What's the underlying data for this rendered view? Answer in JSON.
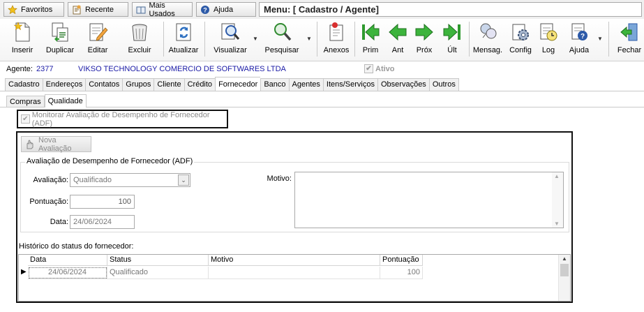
{
  "quickbar": {
    "favoritos": "Favoritos",
    "recente": "Recente",
    "mais_usados": "Mais Usados",
    "ajuda": "Ajuda",
    "menu_title": "Menu: [ Cadastro / Agente]"
  },
  "toolbar": {
    "inserir": "Inserir",
    "duplicar": "Duplicar",
    "editar": "Editar",
    "excluir": "Excluir",
    "atualizar": "Atualizar",
    "visualizar": "Visualizar",
    "pesquisar": "Pesquisar",
    "anexos": "Anexos",
    "prim": "Prim",
    "ant": "Ant",
    "prox": "Próx",
    "ult": "Últ",
    "mensag": "Mensag.",
    "config": "Config",
    "log": "Log",
    "ajuda": "Ajuda",
    "fechar": "Fechar"
  },
  "agent": {
    "label": "Agente:",
    "code": "2377",
    "name": "VIKSO TECHNOLOGY COMERCIO DE SOFTWARES LTDA",
    "ativo": "Ativo"
  },
  "tabs": [
    "Cadastro",
    "Endereços",
    "Contatos",
    "Grupos",
    "Cliente",
    "Crédito",
    "Fornecedor",
    "Banco",
    "Agentes",
    "Itens/Serviços",
    "Observações",
    "Outros"
  ],
  "subtabs": [
    "Compras",
    "Qualidade"
  ],
  "adf": {
    "monitor_label": "Monitorar Avaliação de Desempenho de Fornecedor (ADF)",
    "nova_button": "Nova Avaliação",
    "group_title": "Avaliação de Desempenho de Fornecedor (ADF)",
    "avaliacao_label": "Avaliação:",
    "avaliacao_value": "Qualificado",
    "pontuacao_label": "Pontuação:",
    "pontuacao_value": "100",
    "data_label": "Data:",
    "data_value": "24/06/2024",
    "motivo_label": "Motivo:"
  },
  "history": {
    "label": "Histórico do status do fornecedor:",
    "columns": [
      "Data",
      "Status",
      "Motivo",
      "Pontuação"
    ],
    "rows": [
      {
        "data": "24/06/2024",
        "status": "Qualificado",
        "motivo": "",
        "pontuacao": "100"
      }
    ]
  }
}
